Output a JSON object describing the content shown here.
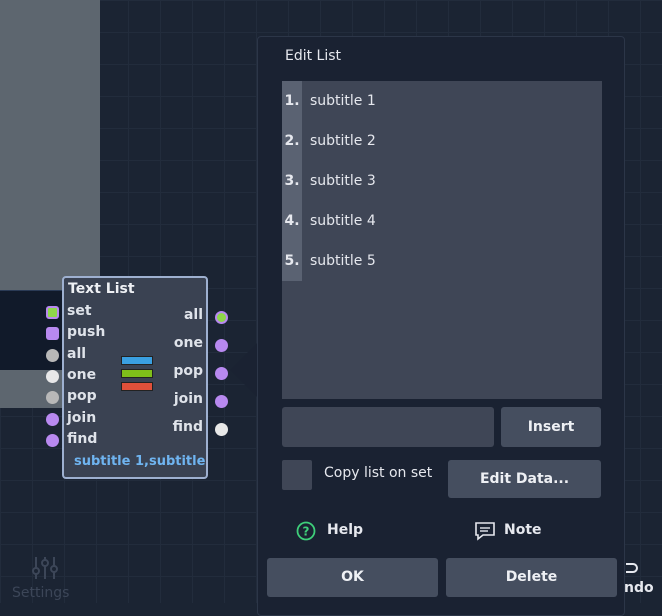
{
  "background": {
    "color": "#1b2433"
  },
  "settings": {
    "label": "Settings"
  },
  "undo": {
    "label": "ndo"
  },
  "node": {
    "title": "Text List",
    "subtitle": "subtitle 1,subtitle",
    "inputs": [
      {
        "label": "set",
        "color": "#8fd64a",
        "ring": "#b889f0"
      },
      {
        "label": "push",
        "color": "#b889f0"
      },
      {
        "label": "all",
        "color": "#b8b8b8"
      },
      {
        "label": "one",
        "color": "#e8e8e8"
      },
      {
        "label": "pop",
        "color": "#b8b8b8"
      },
      {
        "label": "join",
        "color": "#b889f0"
      },
      {
        "label": "find",
        "color": "#b889f0"
      }
    ],
    "outputs": [
      {
        "label": "all",
        "color": "#8fd64a",
        "ring": "#b889f0"
      },
      {
        "label": "one",
        "color": "#b889f0"
      },
      {
        "label": "pop",
        "color": "#b889f0"
      },
      {
        "label": "join",
        "color": "#b889f0"
      },
      {
        "label": "find",
        "color": "#e8e8e8"
      }
    ],
    "icon_colors": [
      "#3a9fe0",
      "#7fbf1a",
      "#e0503a"
    ]
  },
  "dialog": {
    "title": "Edit List",
    "items": [
      {
        "num": "1.",
        "text": "subtitle 1"
      },
      {
        "num": "2.",
        "text": "subtitle 2"
      },
      {
        "num": "3.",
        "text": "subtitle 3"
      },
      {
        "num": "4.",
        "text": "subtitle 4"
      },
      {
        "num": "5.",
        "text": "subtitle 5"
      }
    ],
    "input_value": "",
    "insert_label": "Insert",
    "copy_label": "Copy list on set",
    "edit_data_label": "Edit Data...",
    "help_label": "Help",
    "note_label": "Note",
    "ok_label": "OK",
    "delete_label": "Delete"
  }
}
